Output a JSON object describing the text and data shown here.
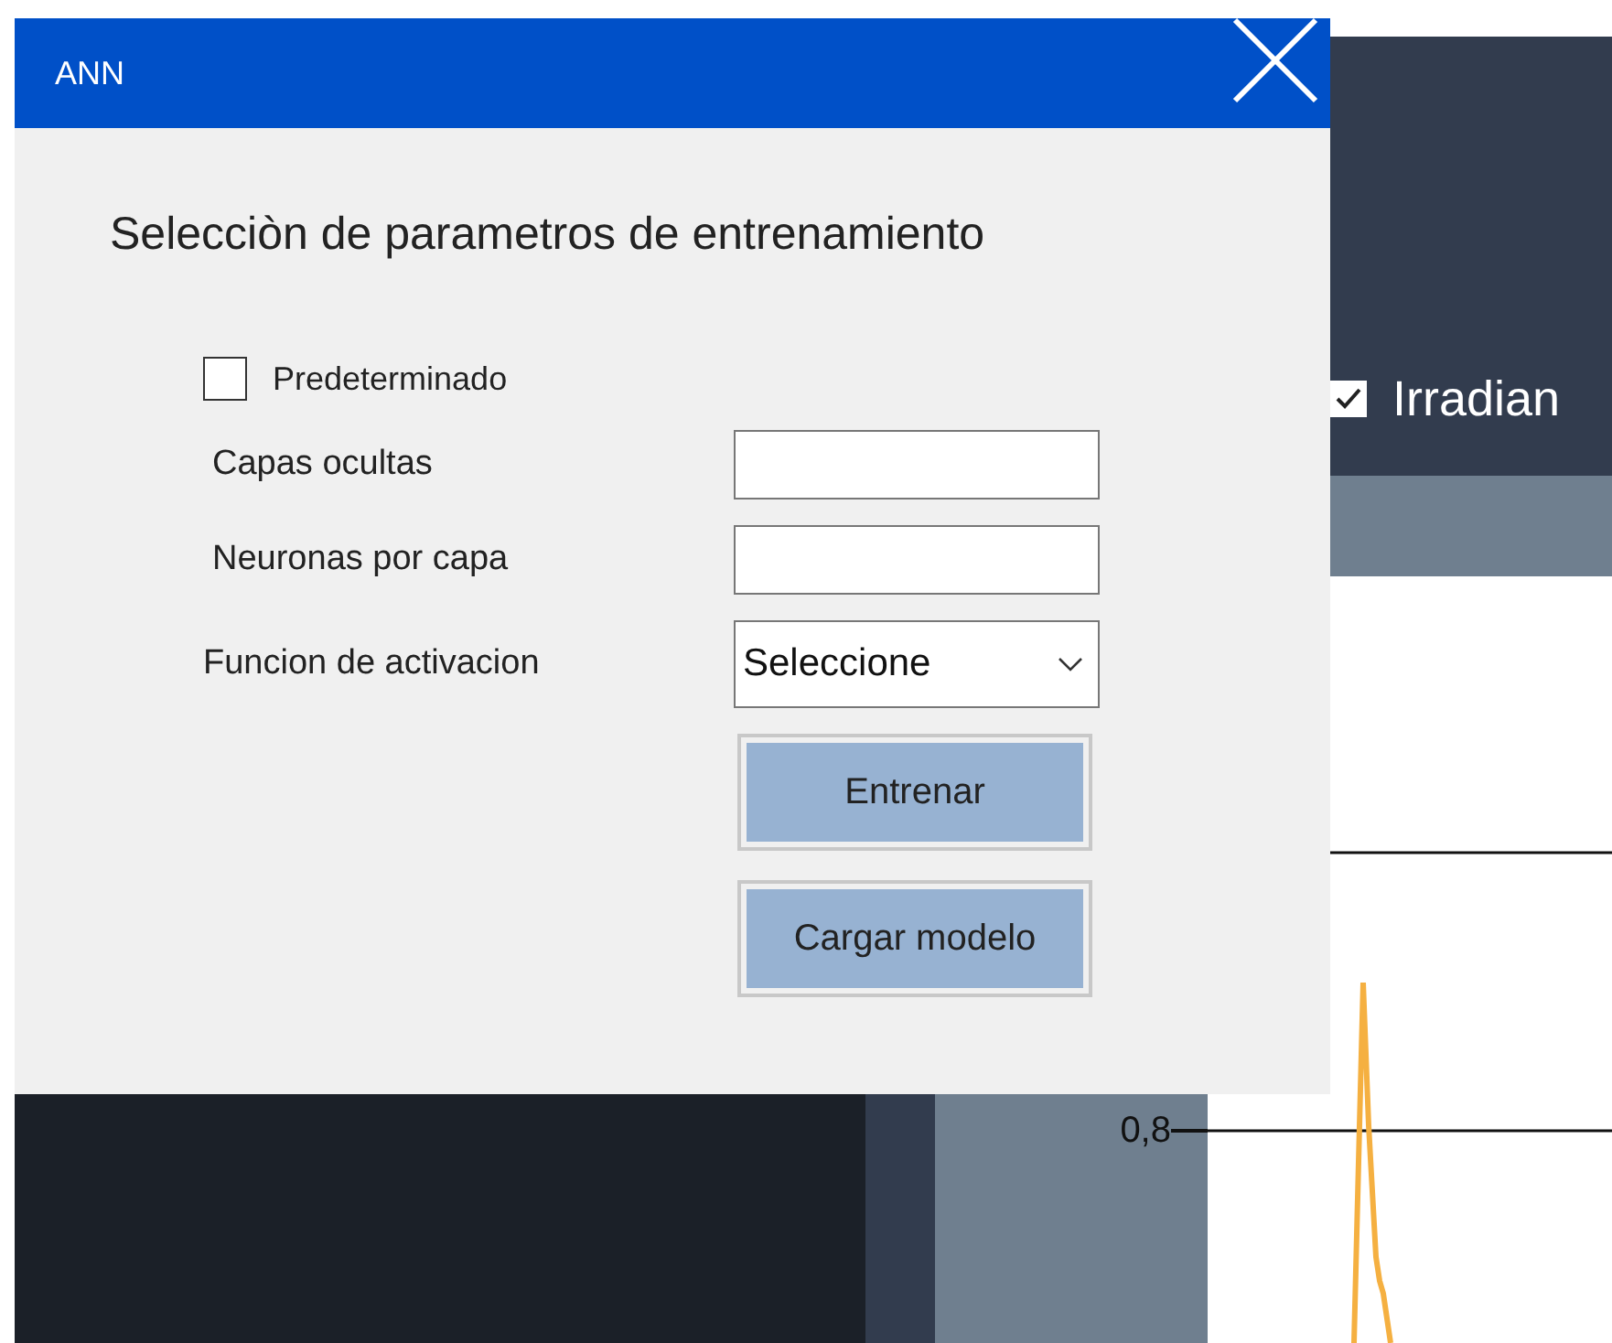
{
  "background_app": {
    "legend": {
      "label": "Irradian",
      "checked": true
    },
    "axis_tick": "0,8"
  },
  "dialog": {
    "title": "ANN",
    "heading": "Selecciòn de parametros de entrenamiento",
    "default_option": {
      "label": "Predeterminado",
      "checked": false
    },
    "fields": [
      {
        "label": "Capas ocultas"
      },
      {
        "label": "Neuronas por capa"
      }
    ],
    "activation": {
      "label": "Funcion de activacion",
      "value": "Seleccione"
    },
    "buttons": [
      {
        "label": "Entrenar"
      },
      {
        "label": "Cargar modelo"
      }
    ]
  }
}
